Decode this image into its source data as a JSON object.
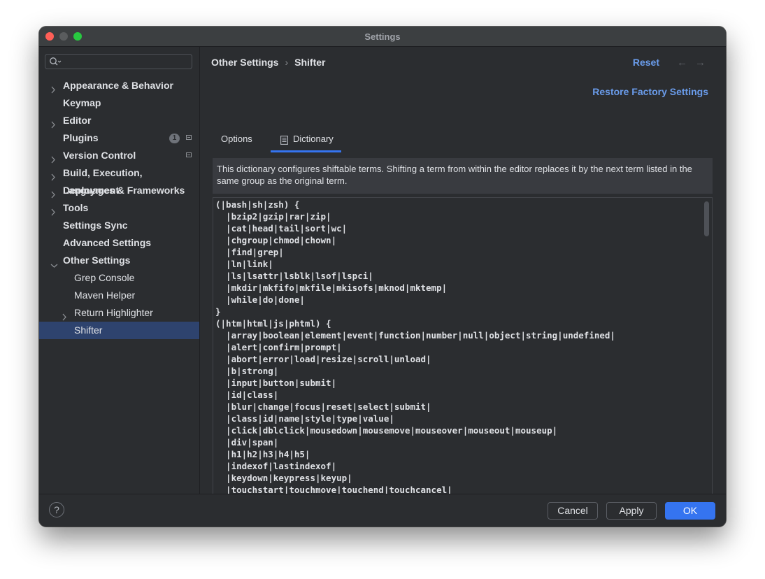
{
  "window": {
    "title": "Settings"
  },
  "sidebar": {
    "search_placeholder": "",
    "items": [
      {
        "label": "Appearance & Behavior",
        "expandable": true
      },
      {
        "label": "Keymap",
        "expandable": false
      },
      {
        "label": "Editor",
        "expandable": true
      },
      {
        "label": "Plugins",
        "expandable": false,
        "badge": "1"
      },
      {
        "label": "Version Control",
        "expandable": true
      },
      {
        "label": "Build, Execution, Deployment",
        "expandable": true
      },
      {
        "label": "Languages & Frameworks",
        "expandable": true
      },
      {
        "label": "Tools",
        "expandable": true
      },
      {
        "label": "Settings Sync",
        "expandable": false
      },
      {
        "label": "Advanced Settings",
        "expandable": false
      },
      {
        "label": "Other Settings",
        "expanded": true
      },
      {
        "label": "Grep Console"
      },
      {
        "label": "Maven Helper"
      },
      {
        "label": "Return Highlighter",
        "expandable": true
      },
      {
        "label": "Shifter",
        "selected": true
      }
    ]
  },
  "header": {
    "breadcrumb_parent": "Other Settings",
    "breadcrumb_separator": "›",
    "breadcrumb_current": "Shifter",
    "reset_label": "Reset",
    "back_arrow": "←",
    "forward_arrow": "→",
    "restore_label": "Restore Factory Settings"
  },
  "tabs": [
    {
      "label": "Options",
      "active": false
    },
    {
      "label": "Dictionary",
      "active": true
    }
  ],
  "info_text": "This dictionary configures shiftable terms. Shifting a term from within the editor replaces it by the next term listed in the same group as the original term.",
  "dictionary_lines": [
    "(|bash|sh|zsh) {",
    "  |bzip2|gzip|rar|zip|",
    "  |cat|head|tail|sort|wc|",
    "  |chgroup|chmod|chown|",
    "  |find|grep|",
    "  |ln|link|",
    "  |ls|lsattr|lsblk|lsof|lspci|",
    "  |mkdir|mkfifo|mkfile|mkisofs|mknod|mktemp|",
    "  |while|do|done|",
    "}",
    "(|htm|html|js|phtml) {",
    "  |array|boolean|element|event|function|number|null|object|string|undefined|",
    "  |alert|confirm|prompt|",
    "  |abort|error|load|resize|scroll|unload|",
    "  |b|strong|",
    "  |input|button|submit|",
    "  |id|class|",
    "  |blur|change|focus|reset|select|submit|",
    "  |class|id|name|style|type|value|",
    "  |click|dblclick|mousedown|mousemove|mouseover|mouseout|mouseup|",
    "  |div|span|",
    "  |h1|h2|h3|h4|h5|",
    "  |indexof|lastindexof|",
    "  |keydown|keypress|keyup|",
    "  |touchstart|touchmove|touchend|touchcancel|"
  ],
  "footer": {
    "help_label": "?",
    "cancel_label": "Cancel",
    "apply_label": "Apply",
    "ok_label": "OK"
  },
  "colors": {
    "accent": "#3574f0",
    "link": "#6a9ceb",
    "selection": "#2e436e",
    "background": "#2b2d30"
  }
}
